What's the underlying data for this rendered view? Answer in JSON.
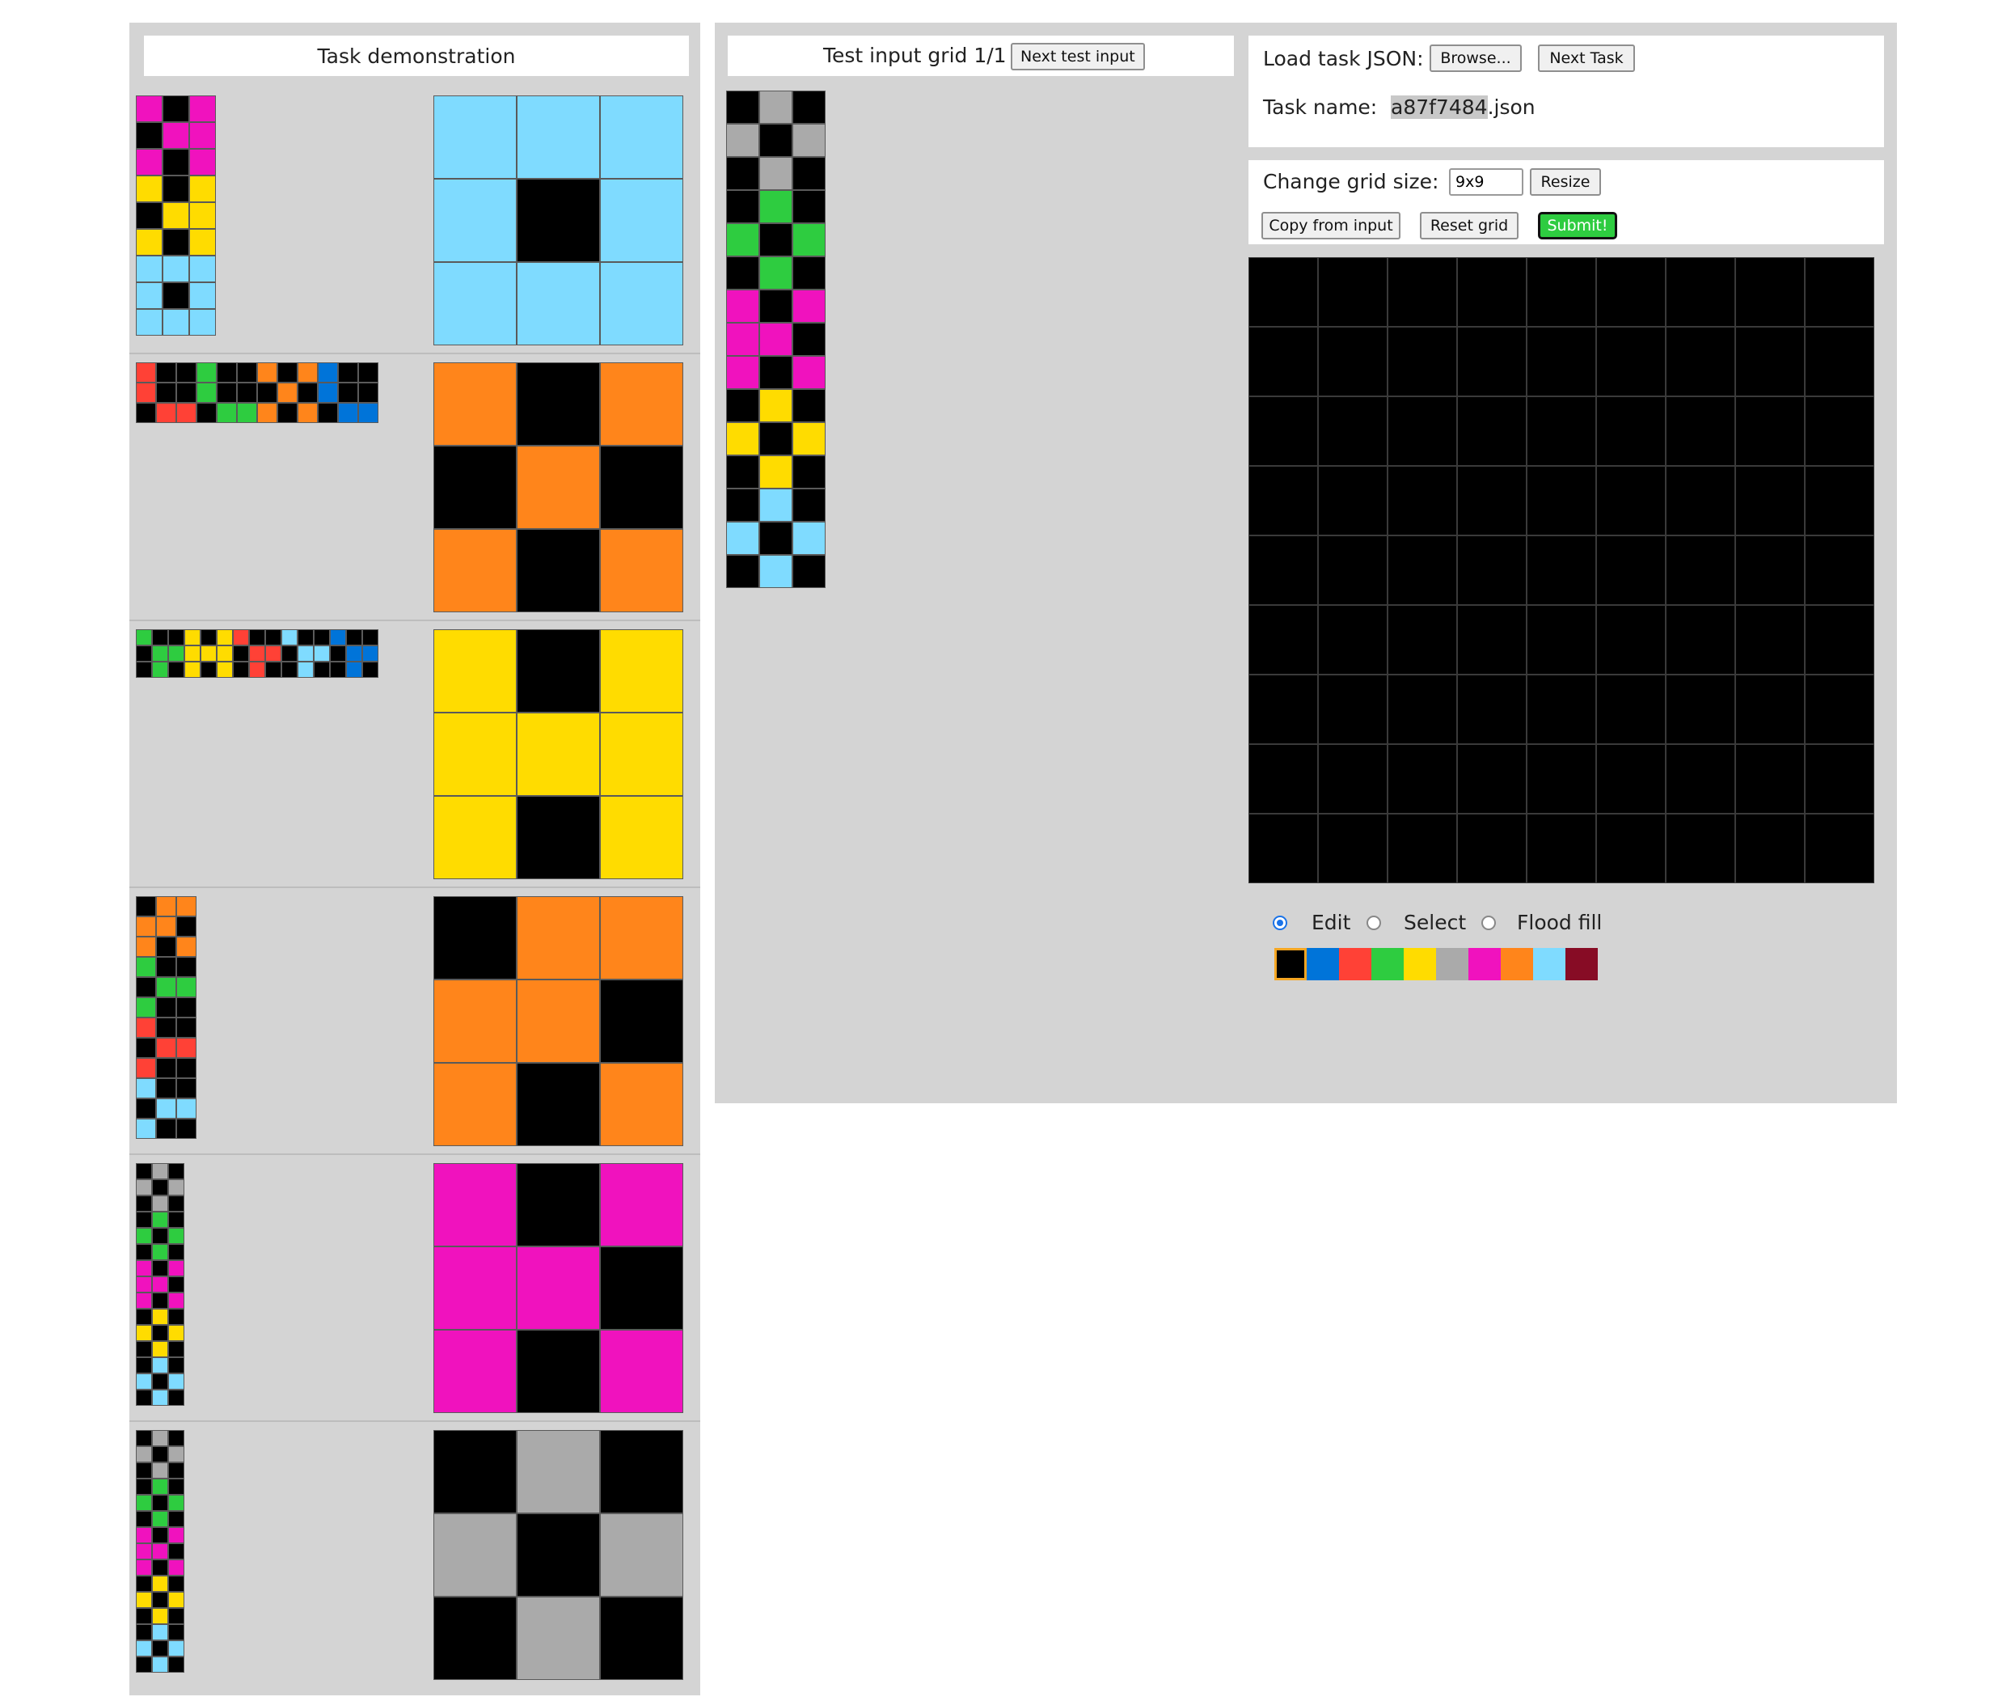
{
  "palette": [
    "#000000",
    "#0074D9",
    "#FF4136",
    "#2ECC40",
    "#FFDC00",
    "#AAAAAA",
    "#F012BE",
    "#FF851B",
    "#7FDBFF",
    "#870C25"
  ],
  "demo": {
    "title": "Task demonstration",
    "pairs": [
      {
        "input": [
          [
            6,
            0,
            6
          ],
          [
            0,
            6,
            6
          ],
          [
            6,
            0,
            6
          ],
          [
            4,
            0,
            4
          ],
          [
            0,
            4,
            4
          ],
          [
            4,
            0,
            4
          ],
          [
            8,
            8,
            8
          ],
          [
            8,
            0,
            8
          ],
          [
            8,
            8,
            8
          ]
        ],
        "output": [
          [
            8,
            8,
            8
          ],
          [
            8,
            0,
            8
          ],
          [
            8,
            8,
            8
          ]
        ]
      },
      {
        "input": [
          [
            2,
            0,
            0,
            3,
            0,
            0,
            7,
            0,
            7,
            1,
            0,
            0
          ],
          [
            2,
            0,
            0,
            3,
            0,
            0,
            0,
            7,
            0,
            1,
            0,
            0
          ],
          [
            0,
            2,
            2,
            0,
            3,
            3,
            7,
            0,
            7,
            0,
            1,
            1
          ]
        ],
        "output": [
          [
            7,
            0,
            7
          ],
          [
            0,
            7,
            0
          ],
          [
            7,
            0,
            7
          ]
        ]
      },
      {
        "input": [
          [
            3,
            0,
            0,
            4,
            0,
            4,
            2,
            0,
            0,
            8,
            0,
            0,
            1,
            0,
            0
          ],
          [
            0,
            3,
            3,
            4,
            4,
            4,
            0,
            2,
            2,
            0,
            8,
            8,
            0,
            1,
            1
          ],
          [
            0,
            3,
            0,
            4,
            0,
            4,
            0,
            2,
            0,
            0,
            8,
            0,
            0,
            1,
            0
          ]
        ],
        "output": [
          [
            4,
            0,
            4
          ],
          [
            4,
            4,
            4
          ],
          [
            4,
            0,
            4
          ]
        ]
      },
      {
        "input": [
          [
            0,
            7,
            7
          ],
          [
            7,
            7,
            0
          ],
          [
            7,
            0,
            7
          ],
          [
            3,
            0,
            0
          ],
          [
            0,
            3,
            3
          ],
          [
            3,
            0,
            0
          ],
          [
            2,
            0,
            0
          ],
          [
            0,
            2,
            2
          ],
          [
            2,
            0,
            0
          ],
          [
            8,
            0,
            0
          ],
          [
            0,
            8,
            8
          ],
          [
            8,
            0,
            0
          ]
        ],
        "output": [
          [
            0,
            7,
            7
          ],
          [
            7,
            7,
            0
          ],
          [
            7,
            0,
            7
          ]
        ]
      },
      {
        "input": [
          [
            0,
            5,
            0
          ],
          [
            5,
            0,
            5
          ],
          [
            0,
            5,
            0
          ],
          [
            0,
            3,
            0
          ],
          [
            3,
            0,
            3
          ],
          [
            0,
            3,
            0
          ],
          [
            6,
            0,
            6
          ],
          [
            6,
            6,
            0
          ],
          [
            6,
            0,
            6
          ],
          [
            0,
            4,
            0
          ],
          [
            4,
            0,
            4
          ],
          [
            0,
            4,
            0
          ],
          [
            0,
            8,
            0
          ],
          [
            8,
            0,
            8
          ],
          [
            0,
            8,
            0
          ]
        ],
        "output": [
          [
            6,
            0,
            6
          ],
          [
            6,
            6,
            0
          ],
          [
            6,
            0,
            6
          ]
        ]
      },
      {
        "input": [
          [
            0,
            5,
            0
          ],
          [
            5,
            0,
            5
          ],
          [
            0,
            5,
            0
          ],
          [
            0,
            3,
            0
          ],
          [
            3,
            0,
            3
          ],
          [
            0,
            3,
            0
          ],
          [
            6,
            0,
            6
          ],
          [
            6,
            6,
            0
          ],
          [
            6,
            0,
            6
          ],
          [
            0,
            4,
            0
          ],
          [
            4,
            0,
            4
          ],
          [
            0,
            4,
            0
          ],
          [
            0,
            8,
            0
          ],
          [
            8,
            0,
            8
          ],
          [
            0,
            8,
            0
          ]
        ],
        "output": [
          [
            0,
            5,
            0
          ],
          [
            5,
            0,
            5
          ],
          [
            0,
            5,
            0
          ]
        ]
      }
    ]
  },
  "test": {
    "title": "Test input grid 1/1",
    "next_test_label": "Next test input",
    "input": [
      [
        0,
        5,
        0
      ],
      [
        5,
        0,
        5
      ],
      [
        0,
        5,
        0
      ],
      [
        0,
        3,
        0
      ],
      [
        3,
        0,
        3
      ],
      [
        0,
        3,
        0
      ],
      [
        6,
        0,
        6
      ],
      [
        6,
        6,
        0
      ],
      [
        6,
        0,
        6
      ],
      [
        0,
        4,
        0
      ],
      [
        4,
        0,
        4
      ],
      [
        0,
        4,
        0
      ],
      [
        0,
        8,
        0
      ],
      [
        8,
        0,
        8
      ],
      [
        0,
        8,
        0
      ]
    ]
  },
  "load": {
    "label": "Load task JSON:",
    "browse_label": "Browse...",
    "next_task_label": "Next Task",
    "task_name_label": "Task name:",
    "task_name_highlight": "a87f7484",
    "task_name_suffix": ".json"
  },
  "controls": {
    "grid_size_label": "Change grid size:",
    "grid_size_value": "9x9",
    "resize_label": "Resize",
    "copy_label": "Copy from input",
    "reset_label": "Reset grid",
    "submit_label": "Submit!"
  },
  "output_grid": {
    "rows": 9,
    "cols": 9,
    "fill": 0
  },
  "tools": {
    "edit_label": "Edit",
    "select_label": "Select",
    "flood_label": "Flood fill",
    "selected": "edit"
  },
  "selected_color": 0
}
